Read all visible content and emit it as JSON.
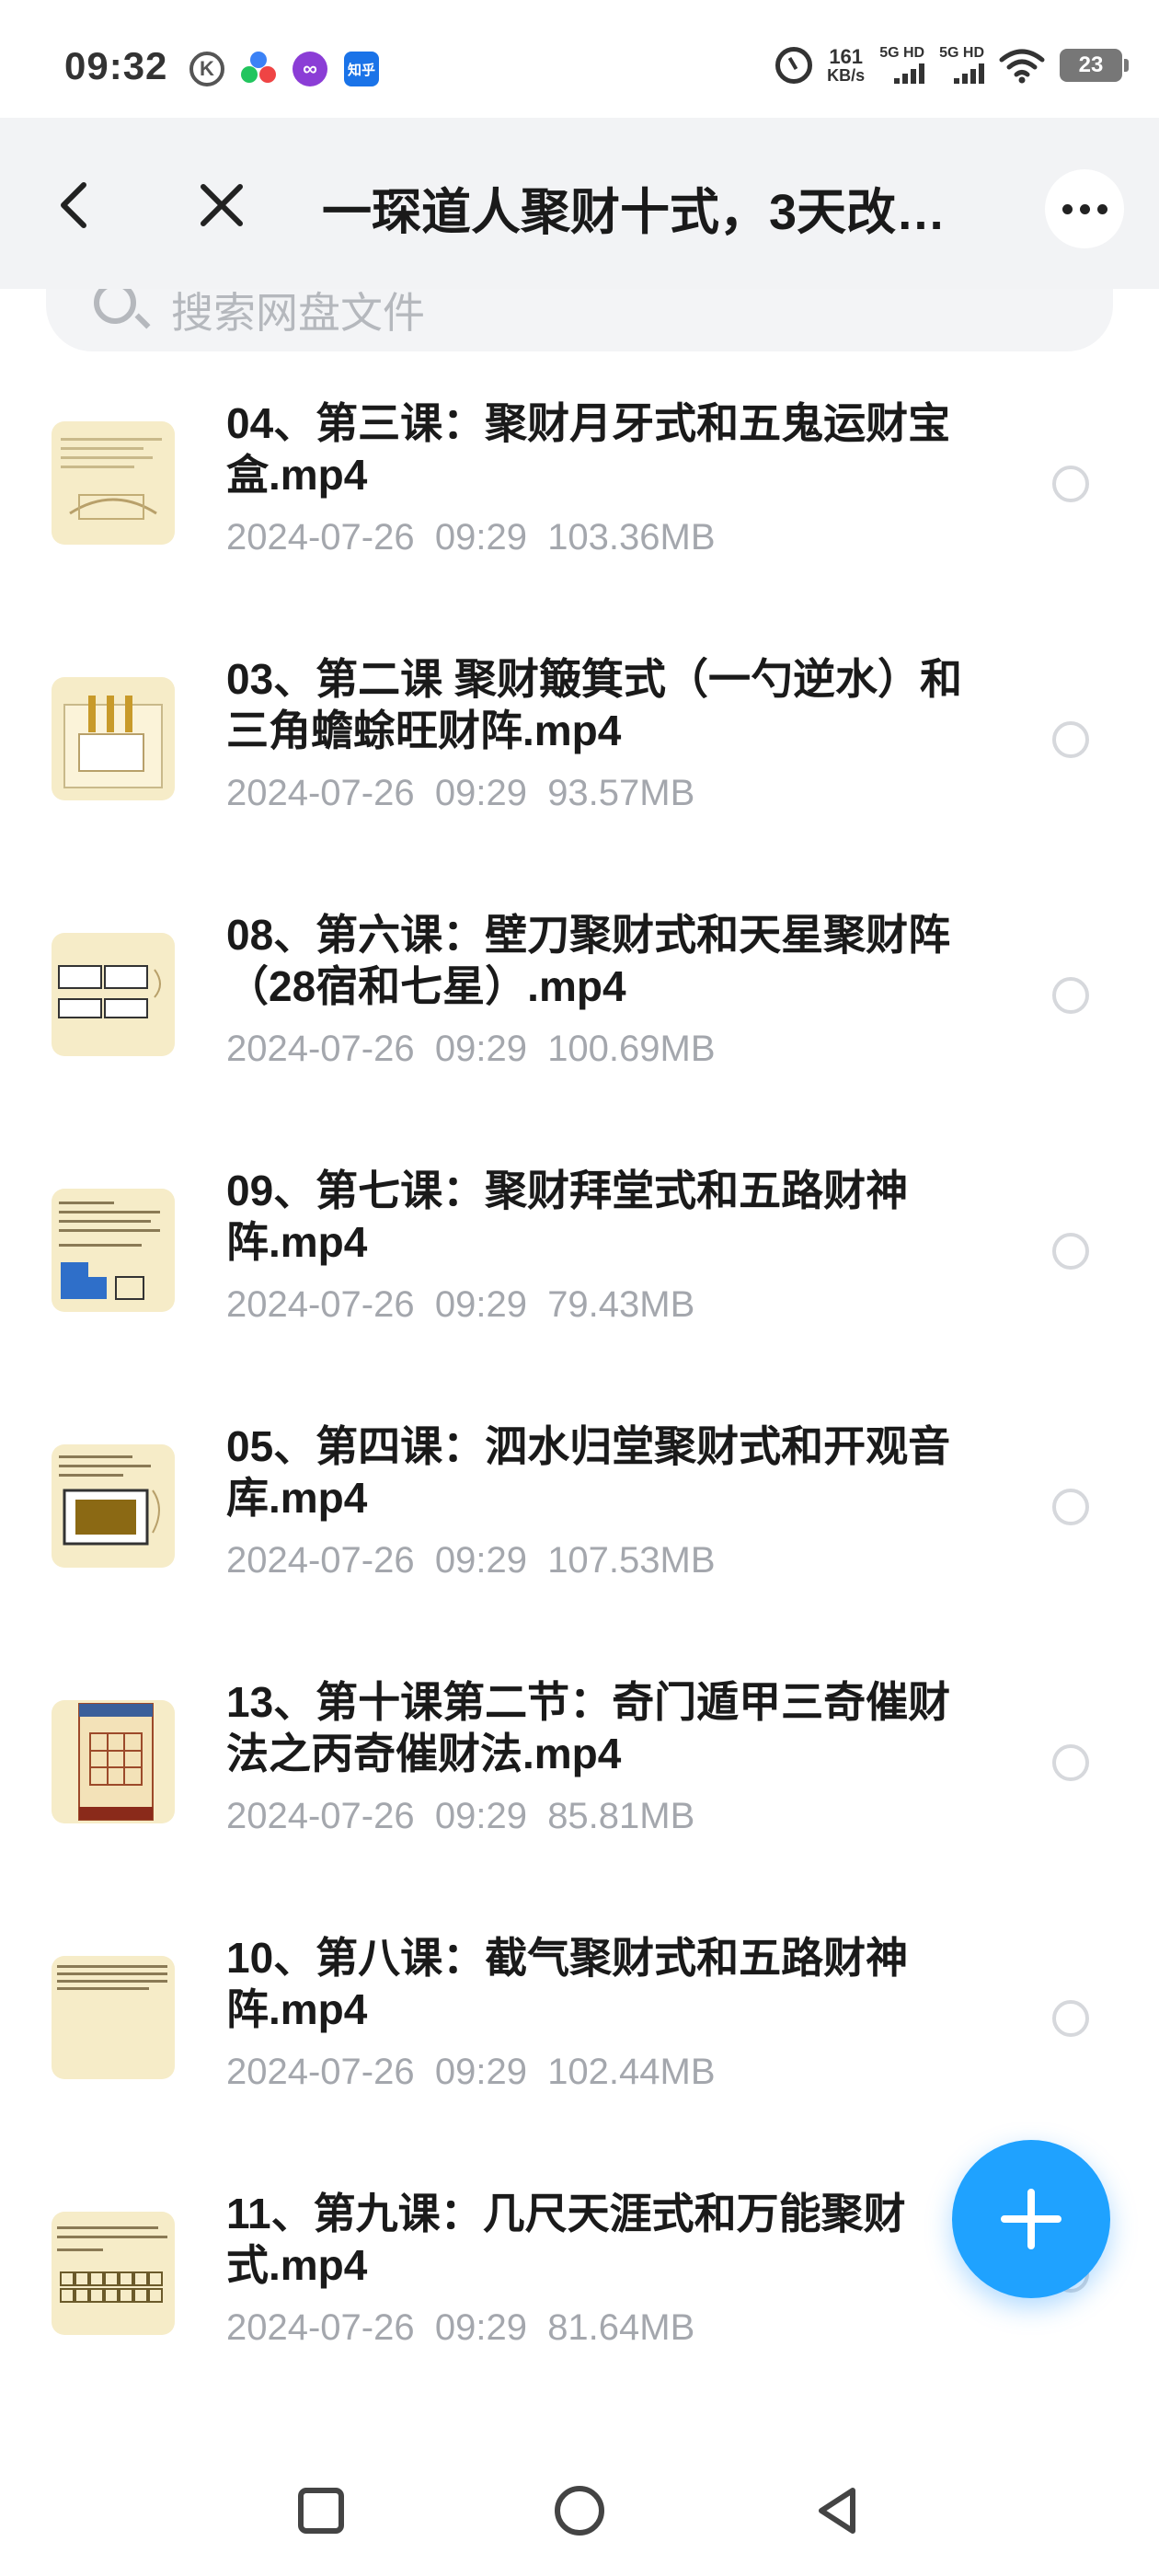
{
  "status_bar": {
    "time": "09:32",
    "app_icons": [
      "k-icon",
      "flower-icon",
      "loop-icon",
      "zhihu-icon"
    ],
    "zhihu_label": "知乎",
    "net_speed": "161",
    "net_speed_unit": "KB/s",
    "signal_1_label": "5G HD",
    "signal_2_label": "5G HD",
    "battery": "23"
  },
  "header": {
    "title": "一琛道人聚财十式，3天改…"
  },
  "search": {
    "placeholder": "搜索网盘文件"
  },
  "files": [
    {
      "name": "04、第三课：聚财月牙式和五鬼运财宝盒.mp4",
      "date": "2024-07-26",
      "time": "09:29",
      "size": "103.36MB"
    },
    {
      "name": "03、第二课 聚财簸箕式（一勺逆水）和三角蟾蜍旺财阵.mp4",
      "date": "2024-07-26",
      "time": "09:29",
      "size": "93.57MB"
    },
    {
      "name": "08、第六课：壁刀聚财式和天星聚财阵（28宿和七星）.mp4",
      "date": "2024-07-26",
      "time": "09:29",
      "size": "100.69MB"
    },
    {
      "name": "09、第七课：聚财拜堂式和五路财神阵.mp4",
      "date": "2024-07-26",
      "time": "09:29",
      "size": "79.43MB"
    },
    {
      "name": "05、第四课：泗水归堂聚财式和开观音库.mp4",
      "date": "2024-07-26",
      "time": "09:29",
      "size": "107.53MB"
    },
    {
      "name": "13、第十课第二节：奇门遁甲三奇催财法之丙奇催财法.mp4",
      "date": "2024-07-26",
      "time": "09:29",
      "size": "85.81MB"
    },
    {
      "name": "10、第八课：截气聚财式和五路财神阵.mp4",
      "date": "2024-07-26",
      "time": "09:29",
      "size": "102.44MB"
    },
    {
      "name": "11、第九课：几尺天涯式和万能聚财式.mp4",
      "date": "2024-07-26",
      "time": "09:29",
      "size": "81.64MB"
    }
  ],
  "colors": {
    "accent": "#1fa2ff",
    "header_bg": "#f2f3f5",
    "meta_text": "#a4a7ad",
    "thumb_bg": "#f6ecc8"
  }
}
